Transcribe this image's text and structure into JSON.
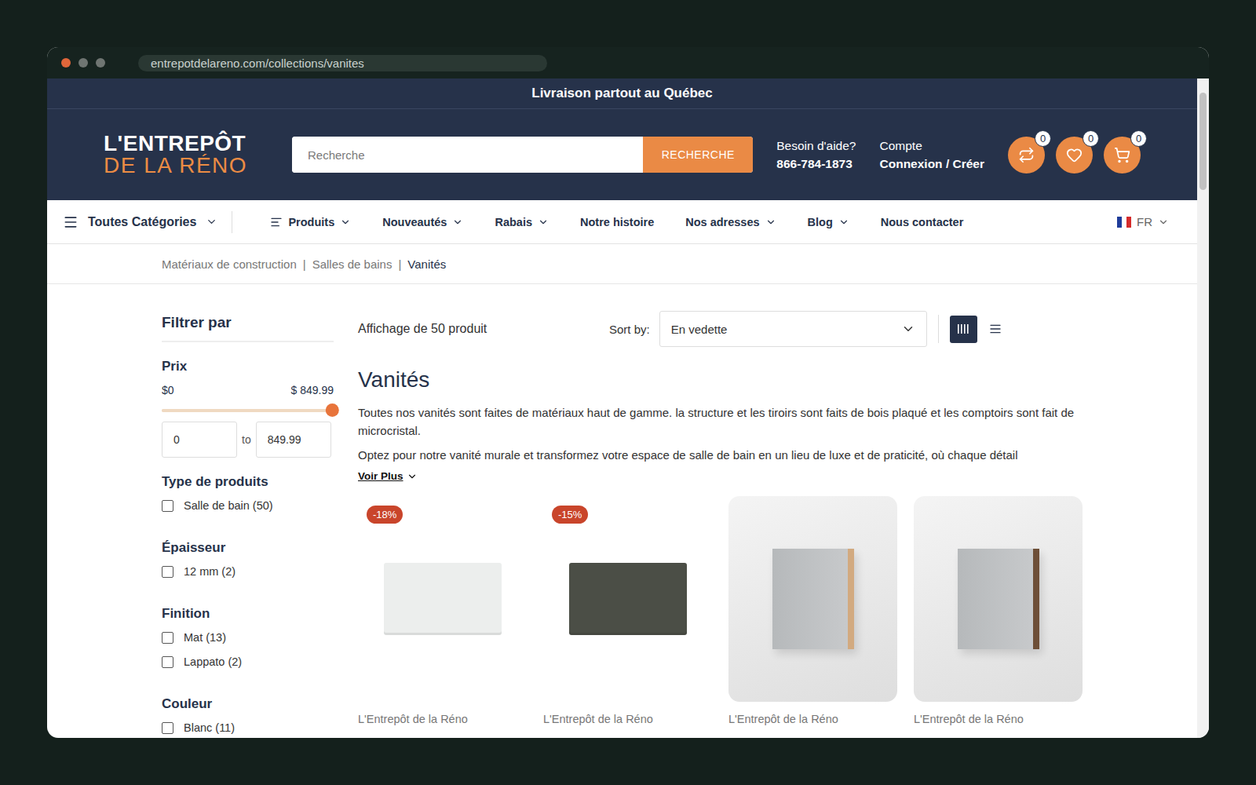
{
  "window": {
    "url": "entrepotdelareno.com/collections/vanites"
  },
  "banner": "Livraison partout au Québec",
  "logo": {
    "line1": "L'ENTREPÔT",
    "line2": "DE LA RÉNO"
  },
  "search": {
    "placeholder": "Recherche",
    "button": "RECHERCHE"
  },
  "help": {
    "label": "Besoin d'aide?",
    "phone": "866-784-1873"
  },
  "account": {
    "label": "Compte",
    "link": "Connexion / Créer"
  },
  "header_icons": [
    {
      "kind": "compare",
      "count": "0"
    },
    {
      "kind": "wishlist",
      "count": "0"
    },
    {
      "kind": "cart",
      "count": "0"
    }
  ],
  "nav": {
    "all_categories": "Toutes Catégories",
    "items": [
      {
        "label": "Produits",
        "dropdown": true,
        "kind": "icon"
      },
      {
        "label": "Nouveautés",
        "dropdown": true,
        "kind": "text"
      },
      {
        "label": "Rabais",
        "dropdown": true,
        "kind": "text"
      },
      {
        "label": "Notre histoire",
        "dropdown": false,
        "kind": "text"
      },
      {
        "label": "Nos adresses",
        "dropdown": true,
        "kind": "text"
      },
      {
        "label": "Blog",
        "dropdown": true,
        "kind": "text"
      },
      {
        "label": "Nous contacter",
        "dropdown": false,
        "kind": "text"
      }
    ],
    "language": "FR"
  },
  "breadcrumb": {
    "separator": "|",
    "items": [
      {
        "label": "Matériaux de construction",
        "current": false
      },
      {
        "label": "Salles de bains",
        "current": false
      },
      {
        "label": "Vanités",
        "current": true
      }
    ]
  },
  "filters": {
    "title": "Filtrer par",
    "price": {
      "label": "Prix",
      "min_label": "$0",
      "max_label": "$ 849.99",
      "level": 1,
      "min_value": "0",
      "max_value": "849.99",
      "to": "to"
    },
    "groups": [
      {
        "title": "Type de produits",
        "options": [
          {
            "label": "Salle de bain (50)",
            "checked": false
          }
        ]
      },
      {
        "title": "Épaisseur",
        "options": [
          {
            "label": "12 mm (2)",
            "checked": false
          }
        ]
      },
      {
        "title": "Finition",
        "options": [
          {
            "label": "Mat (13)",
            "checked": false
          },
          {
            "label": "Lappato (2)",
            "checked": false
          }
        ]
      },
      {
        "title": "Couleur",
        "options": [
          {
            "label": "Blanc (11)",
            "checked": false
          }
        ]
      }
    ]
  },
  "toolbar": {
    "count": "Affichage de 50 produit",
    "sort_label": "Sort by:",
    "sort_value": "En vedette",
    "views": [
      {
        "kind": "grid",
        "selected": true
      },
      {
        "kind": "list",
        "selected": false
      }
    ]
  },
  "collection": {
    "title": "Vanités",
    "description": [
      "Toutes nos vanités sont faites de matériaux haut de gamme. la structure et les tiroirs sont faits de bois plaqué et les comptoirs sont fait de microcristal.",
      "Optez pour notre vanité murale et transformez votre espace de salle de bain en un lieu de luxe et de praticité, où chaque détail"
    ],
    "more": "Voir Plus"
  },
  "products": [
    {
      "badge": "-18%",
      "brand": "L'Entrepôt de la Réno",
      "kind": "sink",
      "color": "#eceeed"
    },
    {
      "badge": "-15%",
      "brand": "L'Entrepôt de la Réno",
      "kind": "sink",
      "color": "#4b4e46"
    },
    {
      "brand": "L'Entrepôt de la Réno",
      "kind": "cabinet",
      "color": "#d2aa80"
    },
    {
      "brand": "L'Entrepôt de la Réno",
      "kind": "cabinet",
      "color": "#6e4f38"
    }
  ]
}
